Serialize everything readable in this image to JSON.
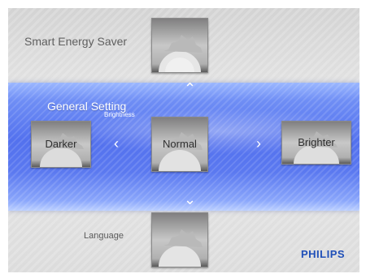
{
  "menu": {
    "prev_item_label": "Smart Energy Saver",
    "current_title": "General Setting",
    "current_subtitle": "Brightness",
    "next_item_label": "Language"
  },
  "brightness": {
    "left_option": "Darker",
    "selected_option": "Normal",
    "right_option": "Brighter"
  },
  "brand": {
    "logo_text": "PHILIPS",
    "logo_color": "#1f4fb8"
  },
  "colors": {
    "band": "#5371ee",
    "background": "#dcdcdc"
  },
  "icons": [
    "chevron-up-icon",
    "chevron-down-icon",
    "chevron-left-icon",
    "chevron-right-icon",
    "gear-icon"
  ]
}
